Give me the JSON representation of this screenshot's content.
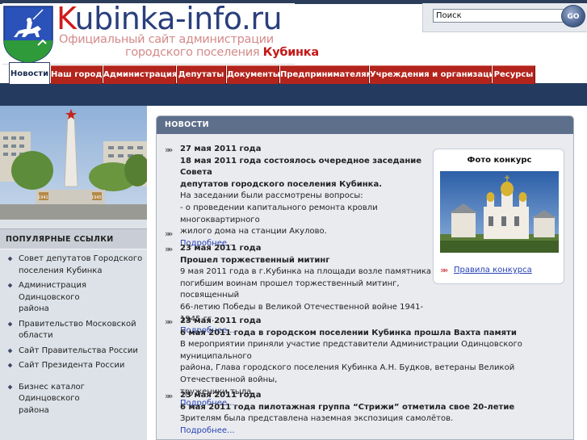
{
  "header": {
    "site_name_k": "K",
    "site_name_rest": "ubinka-info.ru",
    "tagline_line1": "Официальный сайт администрации",
    "tagline_line2_prefix": "городского поселения ",
    "tagline_line2_city": "Кубинка"
  },
  "search": {
    "value": "Поиск",
    "button_label": "GO"
  },
  "nav": {
    "tabs": [
      {
        "label": "Новости",
        "active": true
      },
      {
        "label": "Наш город",
        "active": false
      },
      {
        "label": "Администрация",
        "active": false
      },
      {
        "label": "Депутаты",
        "active": false
      },
      {
        "label": "Документы",
        "active": false
      },
      {
        "label": "Предпринимателям",
        "active": false
      },
      {
        "label": "Учреждения и организации",
        "active": false
      },
      {
        "label": "Ресурсы",
        "active": false
      }
    ]
  },
  "sidebar": {
    "popular_title": "ПОПУЛЯРНЫЕ ССЫЛКИ",
    "links": [
      {
        "line1": "Совет депутатов Городского",
        "line2": "поселения Кубинка"
      },
      {
        "line1": "Администрация Одинцовского",
        "line2": "района"
      },
      {
        "line1": "Правительство Московской",
        "line2": "области"
      },
      {
        "line1": "Сайт Правительства России",
        "line2": ""
      },
      {
        "line1": "Сайт Президента России",
        "line2": ""
      },
      {
        "line1": "Бизнес каталог Одинцовского",
        "line2": "района"
      }
    ]
  },
  "main": {
    "section_title": "НОВОСТИ",
    "news": [
      {
        "date": "27 мая 2011 года",
        "title_line1": "18 мая 2011 года состоялось очередное заседание Совета",
        "title_line2": "депутатов городского поселения Кубинка.",
        "body": [
          "На заседании были рассмотрены вопросы:",
          "- о проведении капитального ремонта кровли многоквартирного",
          "жилого дома на станции Акулово."
        ],
        "more": "Подробнее..."
      },
      {
        "date": "23 мая 2011 года",
        "title_line1": "Прошел торжественный митинг",
        "title_line2": "",
        "body": [
          "9 мая 2011 года в г.Кубинка на площади возле памятника",
          "погибшим воинам прошел торжественный митинг, посвященный",
          "66-летию Победы в Великой Отечественной войне 1941-1945 гг."
        ],
        "more": "Подробнее..."
      },
      {
        "date": "23 мая 2011 года",
        "title_line1": "6 мая 2011 года в городском поселении Кубинка прошла Вахта памяти",
        "title_line2": "",
        "body": [
          "В мероприятии приняли участие представители Администрации Одинцовского муниципального",
          "района, Глава городского поселения Кубинка А.Н. Будков, ветераны Великой Отечественной войны,",
          "труженики тыла."
        ],
        "more": "Подробнее..."
      },
      {
        "date": "23 мая 2011 года",
        "title_line1": "6 мая 2011 года пилотажная группа “Стрижи” отметила свое 20-летие",
        "title_line2": "",
        "body": [
          "Зрителям была представлена наземная экспозиция самолётов."
        ],
        "more": "Подробнее..."
      }
    ],
    "photo_contest": {
      "title": "Фото конкурс",
      "rules_link": "Правила конкурса"
    }
  },
  "banner": {
    "years_left": "1941",
    "years_right": "1945"
  },
  "colors": {
    "nav_red": "#b3241c",
    "navy": "#243a5e",
    "link_blue": "#2742b6"
  }
}
